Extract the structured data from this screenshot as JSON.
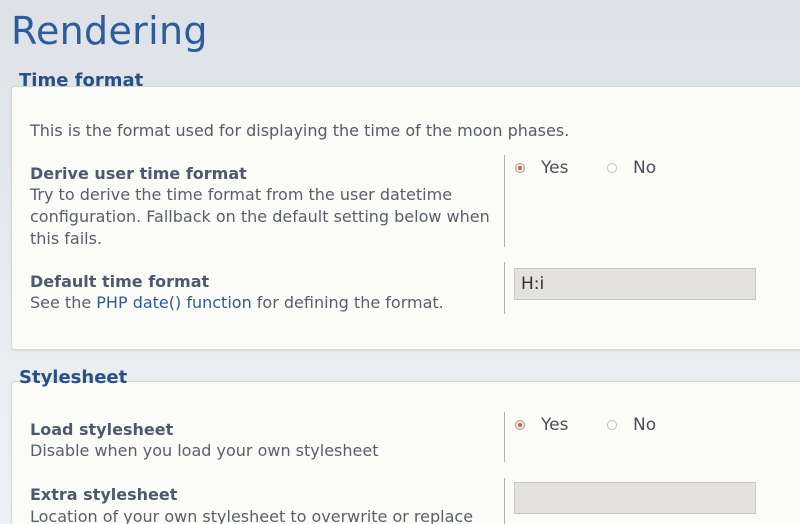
{
  "page": {
    "title": "Rendering"
  },
  "time_format": {
    "legend": "Time format",
    "intro": "This is the format used for displaying the time of the moon phases.",
    "derive": {
      "label": "Derive user time format",
      "desc": "Try to derive the time format from the user datetime configuration. Fallback on the default setting below when this fails.",
      "options": [
        {
          "label": "Yes",
          "checked": true
        },
        {
          "label": "No",
          "checked": false
        }
      ]
    },
    "default_format": {
      "label": "Default time format",
      "desc_prefix": "See the ",
      "desc_link": "PHP date() function",
      "desc_suffix": " for defining the format.",
      "value": "H:i"
    }
  },
  "stylesheet": {
    "legend": "Stylesheet",
    "load": {
      "label": "Load stylesheet",
      "desc": "Disable when you load your own stylesheet",
      "options": [
        {
          "label": "Yes",
          "checked": true
        },
        {
          "label": "No",
          "checked": false
        }
      ]
    },
    "extra": {
      "label": "Extra stylesheet",
      "desc": "Location of your own stylesheet to overwrite or replace",
      "value": ""
    }
  },
  "colors": {
    "title": "#2f5b9b",
    "legend": "#2a4f86",
    "radio_checked": "#b06850"
  }
}
